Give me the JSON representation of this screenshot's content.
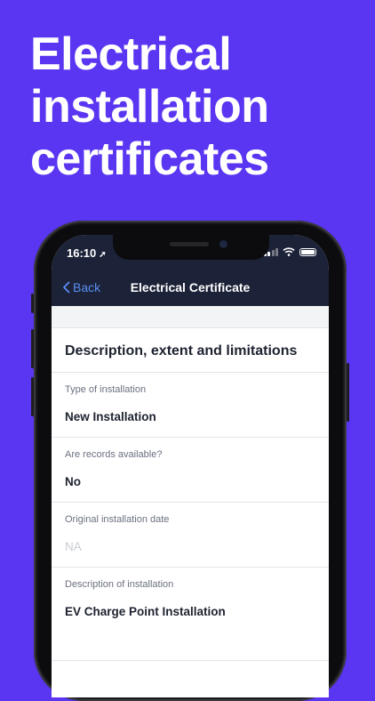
{
  "headline": {
    "line1": "Electrical",
    "line2": "installation",
    "line3": "certificates"
  },
  "status_bar": {
    "time": "16:10",
    "location_icon": "location-arrow-icon",
    "signal_icon": "cellular-signal-icon",
    "wifi_icon": "wifi-icon",
    "battery_icon": "battery-icon"
  },
  "navbar": {
    "back_label": "Back",
    "title": "Electrical Certificate"
  },
  "section": {
    "title": "Description, extent and limitations"
  },
  "fields": [
    {
      "label": "Type of installation",
      "value": "New Installation"
    },
    {
      "label": "Are records available?",
      "value": "No"
    },
    {
      "label": "Original installation date",
      "placeholder": "NA"
    },
    {
      "label": "Description of installation",
      "value": "EV Charge Point Installation"
    }
  ],
  "colors": {
    "background": "#5a36f2",
    "navbar": "#1c2238",
    "accent": "#5b8ef5"
  }
}
